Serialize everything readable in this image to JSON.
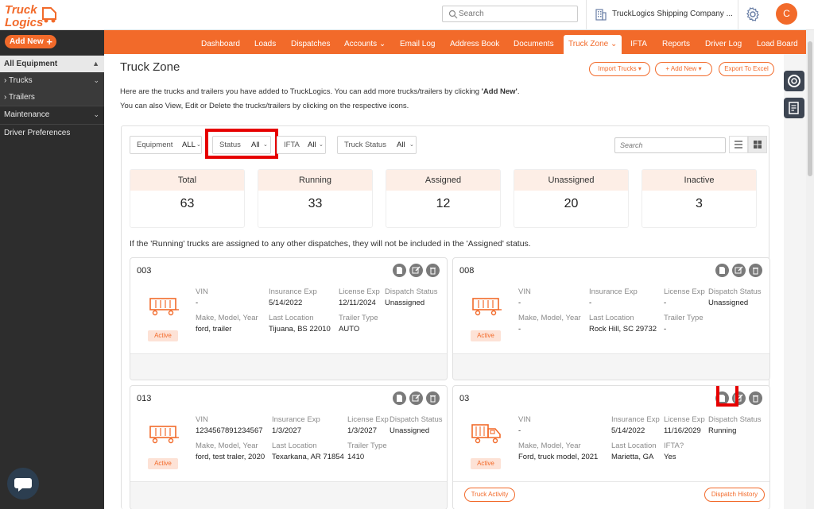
{
  "header": {
    "logo_text": "Truck Logics",
    "search_placeholder": "Search",
    "company": "TruckLogics Shipping Company ...",
    "avatar_initial": "C"
  },
  "sidebar": {
    "add_new": "Add New",
    "items": [
      {
        "label": "All Equipment"
      },
      {
        "label": "Trucks"
      },
      {
        "label": "Trailers"
      },
      {
        "label": "Maintenance"
      },
      {
        "label": "Driver Preferences"
      }
    ]
  },
  "nav": {
    "items": [
      "Dashboard",
      "Loads",
      "Dispatches",
      "Accounts",
      "Email Log",
      "Address Book",
      "Documents",
      "Truck Zone",
      "IFTA",
      "Reports",
      "Driver Log",
      "Load Board"
    ],
    "active": "Truck Zone"
  },
  "page": {
    "title": "Truck Zone",
    "buttons": {
      "import": "Import Trucks",
      "add_new": "+ Add New",
      "export": "Export To Excel"
    },
    "desc_line1_pre": "Here are the trucks and trailers you have added to TruckLogics. You can add more trucks/trailers by clicking ",
    "desc_line1_bold": "'Add New'",
    "desc_line1_post": ".",
    "desc_line2": "You can also View, Edit or Delete the trucks/trailers by clicking on the respective icons."
  },
  "filters": {
    "equipment": {
      "label": "Equipment",
      "value": "ALL"
    },
    "status": {
      "label": "Status",
      "value": "All"
    },
    "ifta": {
      "label": "IFTA",
      "value": "All"
    },
    "truck_status": {
      "label": "Truck Status",
      "value": "All"
    },
    "search_placeholder": "Search"
  },
  "stats": [
    {
      "label": "Total",
      "value": "63"
    },
    {
      "label": "Running",
      "value": "33"
    },
    {
      "label": "Assigned",
      "value": "12"
    },
    {
      "label": "Unassigned",
      "value": "20"
    },
    {
      "label": "Inactive",
      "value": "3"
    }
  ],
  "note": "If the 'Running' trucks are assigned to any other dispatches, they will not be included in the 'Assigned' status.",
  "cards": [
    {
      "number": "003",
      "type": "trailer",
      "badge": "Active",
      "vin_label": "VIN",
      "vin": "-",
      "ins_label": "Insurance Exp",
      "ins": "5/14/2022",
      "lic_label": "License Exp",
      "lic": "12/11/2024",
      "disp_label": "Dispatch Status",
      "disp": "Unassigned",
      "mmy_label": "Make, Model, Year",
      "mmy": "ford, trailer",
      "loc_label": "Last Location",
      "loc": "Tijuana, BS 22010",
      "extra_label": "Trailer Type",
      "extra": "AUTO"
    },
    {
      "number": "008",
      "type": "trailer",
      "badge": "Active",
      "vin_label": "VIN",
      "vin": "-",
      "ins_label": "Insurance Exp",
      "ins": "-",
      "lic_label": "License Exp",
      "lic": "-",
      "disp_label": "Dispatch Status",
      "disp": "Unassigned",
      "mmy_label": "Make, Model, Year",
      "mmy": "-",
      "loc_label": "Last Location",
      "loc": "Rock Hill, SC 29732",
      "extra_label": "Trailer Type",
      "extra": "-"
    },
    {
      "number": "013",
      "type": "trailer",
      "badge": "Active",
      "vin_label": "VIN",
      "vin": "1234567891234567",
      "ins_label": "Insurance Exp",
      "ins": "1/3/2027",
      "lic_label": "License Exp",
      "lic": "1/3/2027",
      "disp_label": "Dispatch Status",
      "disp": "Unassigned",
      "mmy_label": "Make, Model, Year",
      "mmy": "ford, test traler, 2020",
      "loc_label": "Last Location",
      "loc": "Texarkana, AR 71854",
      "extra_label": "Trailer Type",
      "extra": "1410"
    },
    {
      "number": "03",
      "type": "truck",
      "badge": "Active",
      "vin_label": "VIN",
      "vin": "-",
      "ins_label": "Insurance Exp",
      "ins": "5/14/2022",
      "lic_label": "License Exp",
      "lic": "11/16/2029",
      "disp_label": "Dispatch Status",
      "disp": "Running",
      "mmy_label": "Make, Model, Year",
      "mmy": "Ford, truck model, 2021",
      "loc_label": "Last Location",
      "loc": "Marietta, GA",
      "extra_label": "IFTA?",
      "extra": "Yes",
      "footer_left": "Truck Activity",
      "footer_right": "Dispatch History"
    }
  ],
  "colors": {
    "brand": "#f26a2a",
    "sidebar": "#2d2d2d",
    "highlight": "#e60000"
  }
}
